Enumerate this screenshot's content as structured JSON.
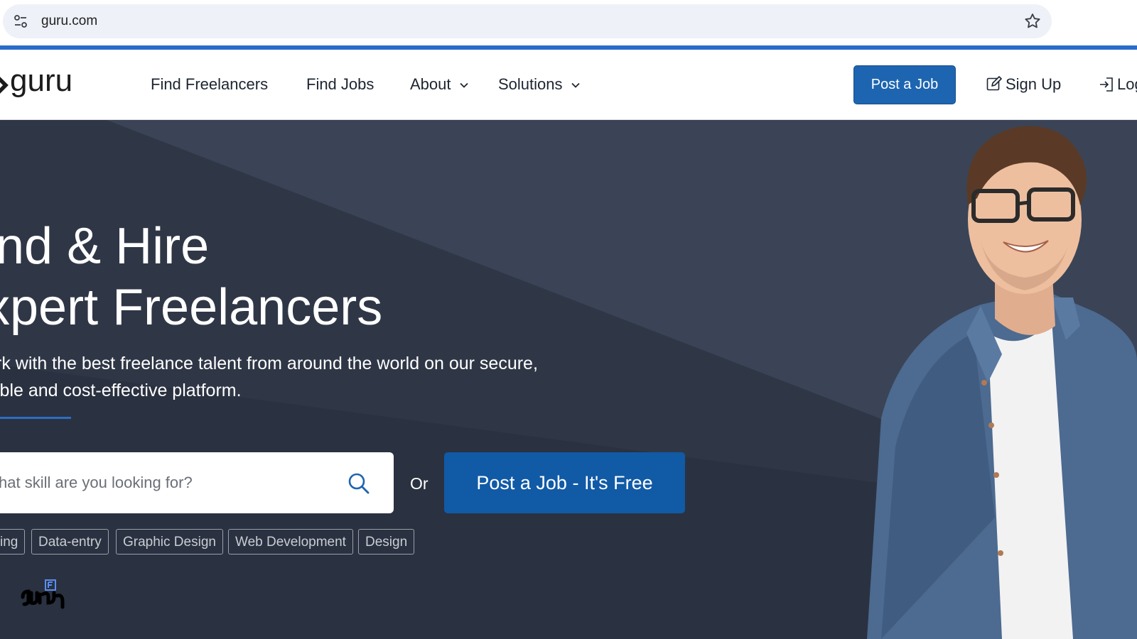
{
  "browser": {
    "url": "guru.com",
    "icons": {
      "site_info": "tune-icon",
      "bookmark": "star-icon"
    }
  },
  "nav": {
    "logo_text": "guru",
    "links": [
      "Find Freelancers",
      "Find Jobs",
      "About",
      "Solutions"
    ],
    "post_job": "Post a Job",
    "sign_up": "Sign Up",
    "login": "Log"
  },
  "hero": {
    "title_line1": "ind & Hire",
    "title_line2": "xpert Freelancers",
    "subtitle_line1": "rk with the best freelance talent from around the world on our secure,",
    "subtitle_line2": "ible and cost-effective platform.",
    "search_placeholder": "hat skill are you looking for?",
    "or_label": "Or",
    "post_job_button": "Post a Job - It's Free",
    "tags": [
      "ing",
      "Data-entry",
      "Graphic Design",
      "Web Development",
      "Design"
    ]
  },
  "colors": {
    "brand_blue": "#1d65b0",
    "hero_bg": "#2f3747",
    "hero_bg_light": "#3a4456",
    "progress": "#2a6cc9"
  }
}
